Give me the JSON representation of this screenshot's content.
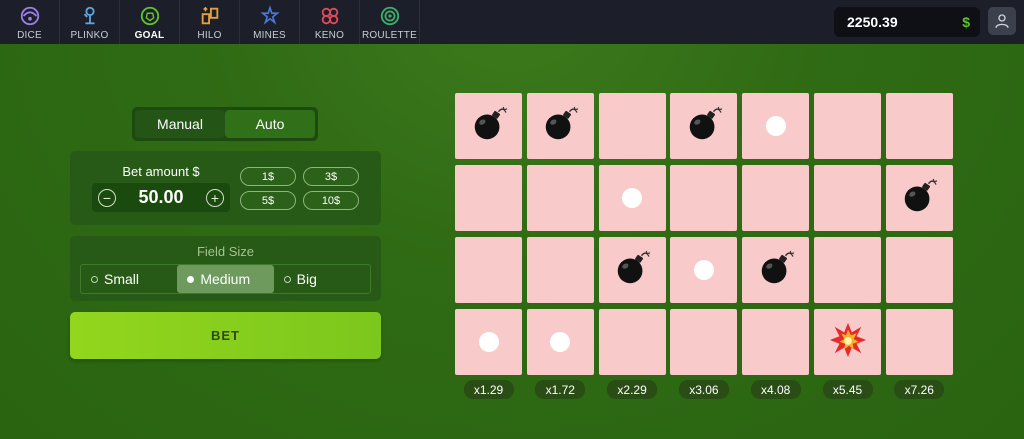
{
  "nav": {
    "items": [
      {
        "label": "DICE",
        "icon": "dice-icon",
        "active": false
      },
      {
        "label": "PLINKO",
        "icon": "plinko-icon",
        "active": false
      },
      {
        "label": "GOAL",
        "icon": "goal-icon",
        "active": true
      },
      {
        "label": "HILO",
        "icon": "hilo-icon",
        "active": false
      },
      {
        "label": "MINES",
        "icon": "mines-icon",
        "active": false
      },
      {
        "label": "KENO",
        "icon": "keno-icon",
        "active": false
      },
      {
        "label": "ROULETTE",
        "icon": "roulette-icon",
        "active": false
      }
    ]
  },
  "header": {
    "balance": "2250.39",
    "currency": "$"
  },
  "mode": {
    "manual": "Manual",
    "auto": "Auto",
    "selected": "Manual"
  },
  "bet": {
    "label": "Bet amount $",
    "value": "50.00",
    "quick": [
      "1$",
      "3$",
      "5$",
      "10$"
    ]
  },
  "field": {
    "title": "Field Size",
    "options": [
      "Small",
      "Medium",
      "Big"
    ],
    "selected": "Medium"
  },
  "bet_button": "BET",
  "grid": {
    "columns": 7,
    "rows": 4,
    "cells": [
      [
        "bomb",
        "bomb",
        "empty",
        "bomb",
        "gem",
        "empty",
        "empty"
      ],
      [
        "empty",
        "empty",
        "gem",
        "empty",
        "empty",
        "empty",
        "bomb"
      ],
      [
        "empty",
        "empty",
        "bomb",
        "gem",
        "bomb",
        "empty",
        "empty"
      ],
      [
        "gem",
        "gem",
        "empty",
        "empty",
        "empty",
        "explosion",
        "empty"
      ]
    ]
  },
  "multipliers": [
    "x1.29",
    "x1.72",
    "x2.29",
    "x3.06",
    "x4.08",
    "x5.45",
    "x7.26"
  ],
  "colors": {
    "accent": "#8fd11d",
    "cell": "#f8caca",
    "background": "#2f6a14"
  }
}
